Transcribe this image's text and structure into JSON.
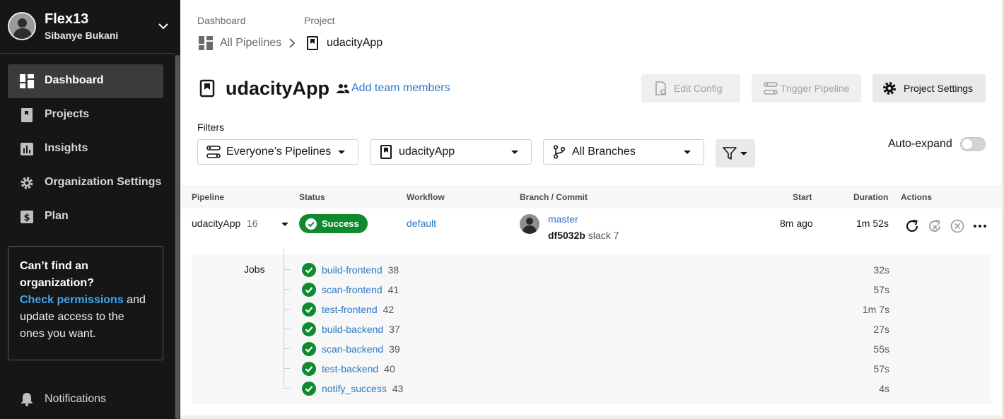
{
  "user": {
    "name": "Flex13",
    "org": "Sibanye Bukani"
  },
  "sidebar": {
    "items": [
      {
        "label": "Dashboard",
        "icon": "dashboard-icon",
        "active": true
      },
      {
        "label": "Projects",
        "icon": "projects-icon"
      },
      {
        "label": "Insights",
        "icon": "insights-icon"
      },
      {
        "label": "Organization Settings",
        "icon": "gear-icon"
      },
      {
        "label": "Plan",
        "icon": "dollar-icon"
      }
    ],
    "help": {
      "title": "Can’t find an organization?",
      "link": "Check permissions",
      "rest": " and update access to the ones you want."
    },
    "notifications": "Notifications"
  },
  "breadcrumb": {
    "dashboard_small": "Dashboard",
    "project_small": "Project",
    "all_pipelines": "All Pipelines",
    "project": "udacityApp"
  },
  "header": {
    "title": "udacityApp",
    "add_team": "Add team members",
    "edit_config": "Edit Config",
    "trigger_pipeline": "Trigger Pipeline",
    "project_settings": "Project Settings"
  },
  "filters": {
    "label": "Filters",
    "pipelines": "Everyone’s Pipelines",
    "project": "udacityApp",
    "branches": "All Branches",
    "auto_expand": "Auto-expand"
  },
  "table": {
    "columns": [
      "Pipeline",
      "Status",
      "Workflow",
      "Branch / Commit",
      "Start",
      "Duration",
      "Actions"
    ],
    "row": {
      "pipeline": "udacityApp",
      "number": "16",
      "status": "Success",
      "workflow": "default",
      "branch": "master",
      "commit_hash": "df5032b",
      "commit_msg": "slack 7",
      "start": "8m ago",
      "duration": "1m 52s"
    },
    "jobs_label": "Jobs",
    "jobs": [
      {
        "name": "build-frontend",
        "num": "38",
        "duration": "32s"
      },
      {
        "name": "scan-frontend",
        "num": "41",
        "duration": "57s"
      },
      {
        "name": "test-frontend",
        "num": "42",
        "duration": "1m 7s"
      },
      {
        "name": "build-backend",
        "num": "37",
        "duration": "27s"
      },
      {
        "name": "scan-backend",
        "num": "39",
        "duration": "55s"
      },
      {
        "name": "test-backend",
        "num": "40",
        "duration": "57s"
      },
      {
        "name": "notify_success",
        "num": "43",
        "duration": "4s"
      }
    ]
  },
  "colors": {
    "success": "#0f8a2f",
    "link": "#2b78c5",
    "sidebar": "#161616"
  }
}
